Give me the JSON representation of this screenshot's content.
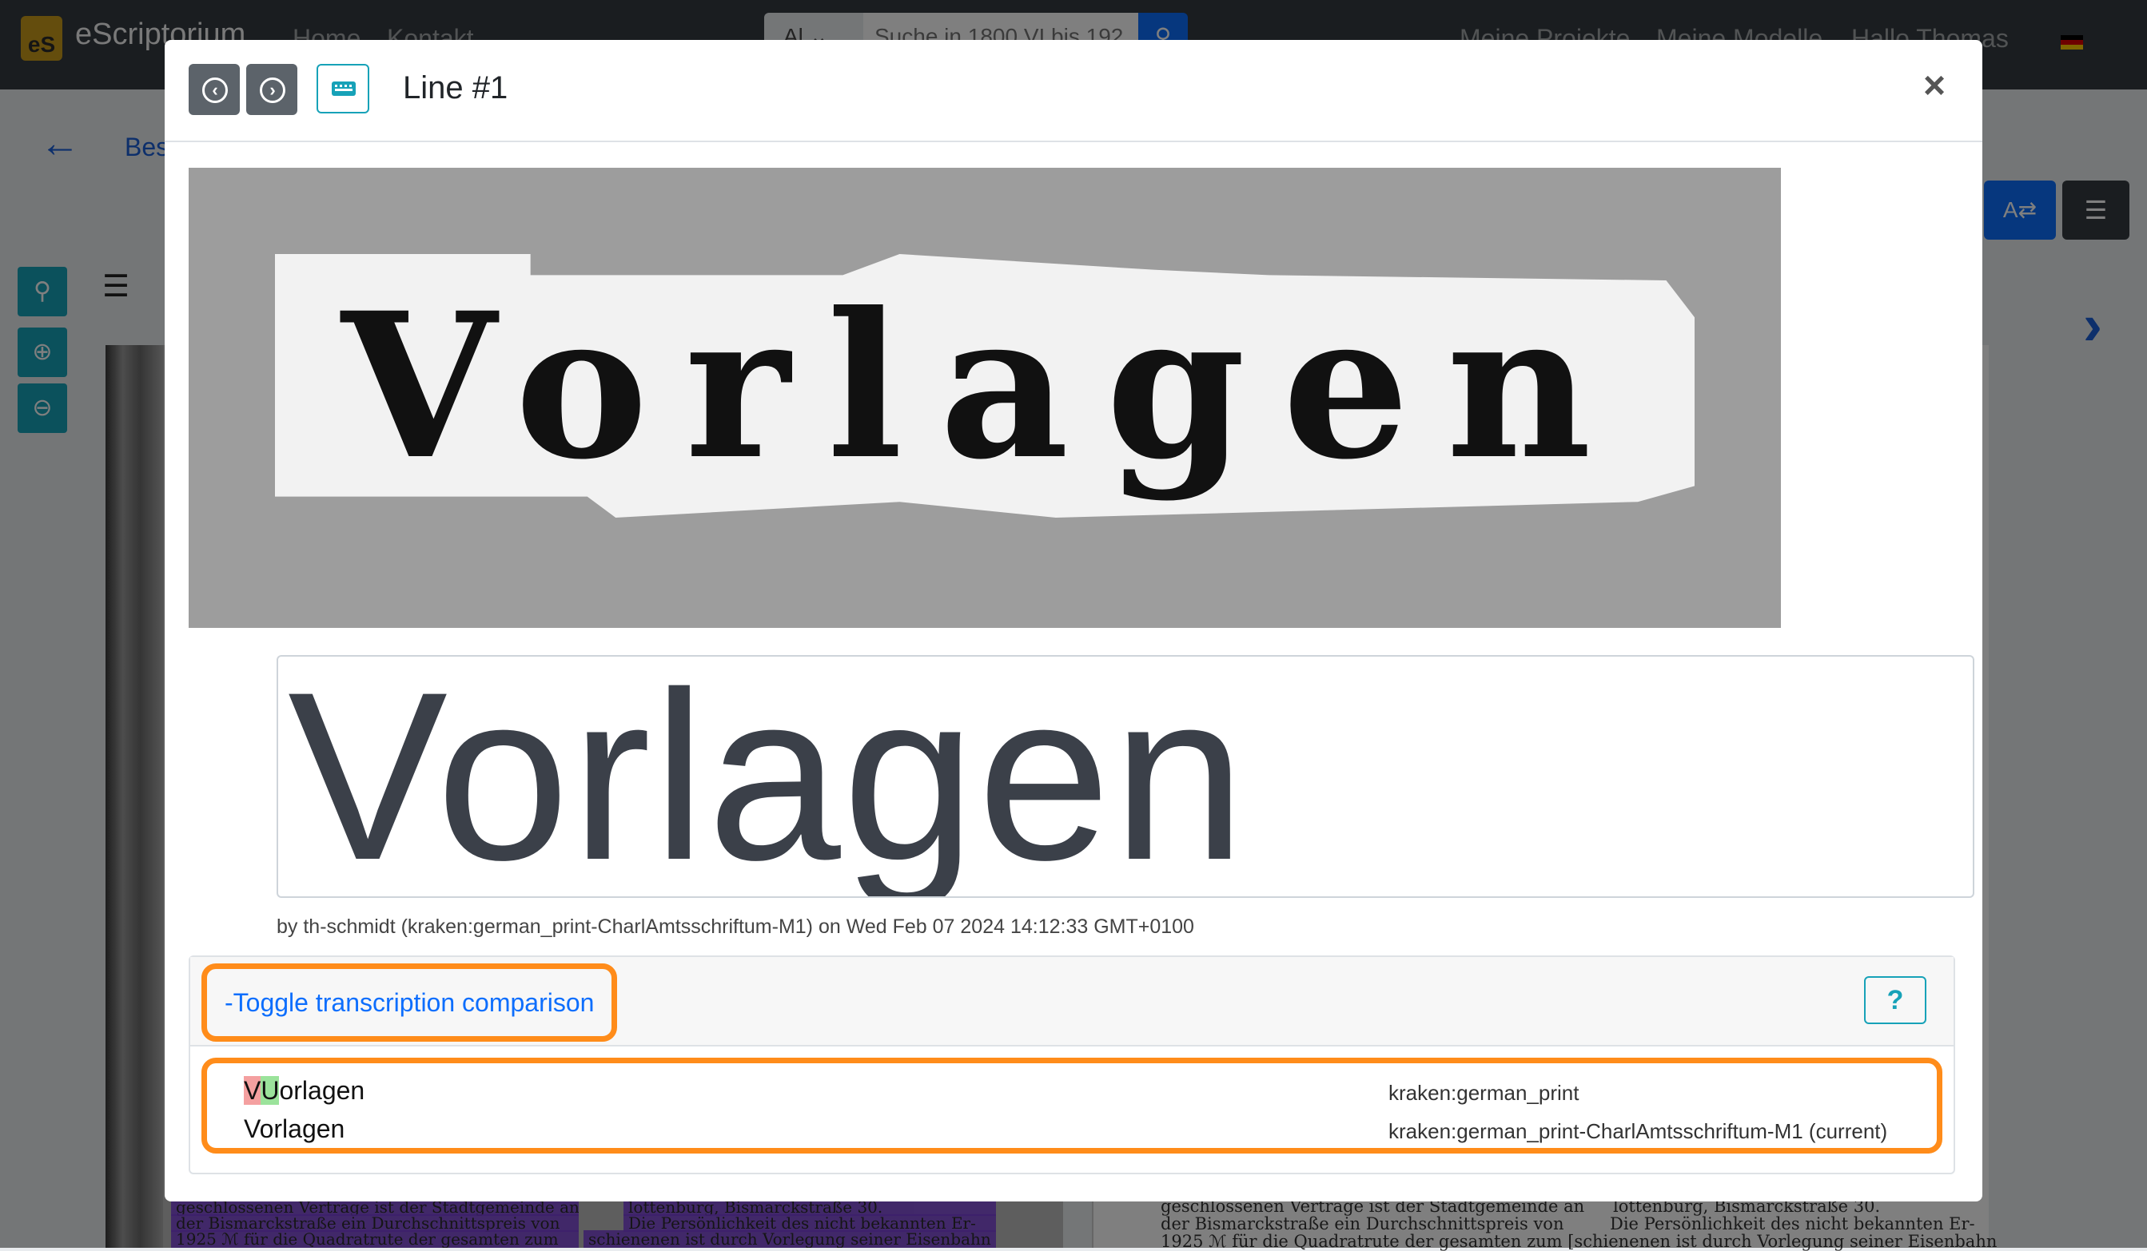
{
  "app": {
    "brand": "eScriptorium",
    "logo_text": "eS",
    "nav_links": [
      "Home",
      "Kontakt"
    ],
    "search": {
      "scope": "Al",
      "placeholder": "Suche in 1800 VI bis 192"
    },
    "right_links": [
      "Meine Projekte",
      "Meine Modelle",
      "Hallo Thomas"
    ],
    "back_label": "Bes"
  },
  "modal": {
    "title": "Line #1",
    "line_image_text": "Vorlagen",
    "transcription": "Vorlagen",
    "meta": "by th-schmidt (kraken:german_print-CharlAmtsschriftum-M1) on Wed Feb 07 2024 14:12:33 GMT+0100",
    "toggle_label": "-Toggle transcription comparison",
    "help_label": "?",
    "comparisons": [
      {
        "deleted": "V",
        "inserted": "U",
        "rest": "orlagen",
        "model": "kraken:german_print"
      },
      {
        "text": "Vorlagen",
        "model": "kraken:german_print-CharlAmtsschriftum-M1 (current)"
      }
    ]
  },
  "background": {
    "right_lines": [
      "geschlossenen Vertrage ist der Stadtgemeinde an",
      "der Bismarckstraße ein Durchschnittspreis von",
      "1925 ℳ für die Quadratrute der gesamten zum [schienenen ist durch Vorlegung seiner Eisenbahn"
    ],
    "right_col2": [
      "lottenburg, Bismarckstraße 30.",
      "Die Persönlichkeit des nicht bekannten Er-"
    ],
    "left_lines": [
      "geschlossenen Vertrage ist der Stadtgemeinde an",
      "der Bismarckstraße ein Durchschnittspreis von",
      "1925 ℳ für die Quadratrute der gesamten zum"
    ],
    "left_col2": [
      "lottenburg, Bismarckstraße 30.",
      "Die Persönlichkeit des nicht bekannten Er-",
      "schienenen ist durch Vorlegung seiner Eisenbahn"
    ]
  }
}
